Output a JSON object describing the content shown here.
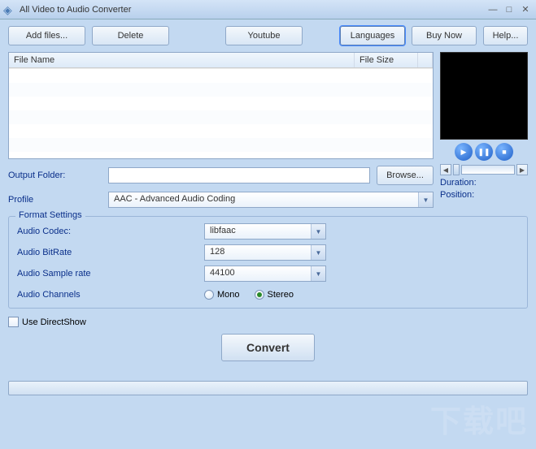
{
  "window": {
    "title": "All Video to Audio Converter"
  },
  "toolbar": {
    "addfiles": "Add files...",
    "delete": "Delete",
    "youtube": "Youtube",
    "languages": "Languages",
    "buynow": "Buy Now",
    "help": "Help..."
  },
  "filelist": {
    "col_name": "File Name",
    "col_size": "File Size"
  },
  "output": {
    "label": "Output Folder:",
    "browse": "Browse...",
    "value": ""
  },
  "profile": {
    "label": "Profile",
    "value": "AAC - Advanced Audio Coding"
  },
  "preview": {
    "duration_label": "Duration:",
    "position_label": "Position:"
  },
  "format": {
    "legend": "Format Settings",
    "codec_label": "Audio Codec:",
    "codec_value": "libfaac",
    "bitrate_label": "Audio BitRate",
    "bitrate_value": "128",
    "sample_label": "Audio Sample rate",
    "sample_value": "44100",
    "channels_label": "Audio Channels",
    "mono": "Mono",
    "stereo": "Stereo",
    "selected_channel": "stereo"
  },
  "options": {
    "directshow": "Use DirectShow"
  },
  "actions": {
    "convert": "Convert"
  }
}
